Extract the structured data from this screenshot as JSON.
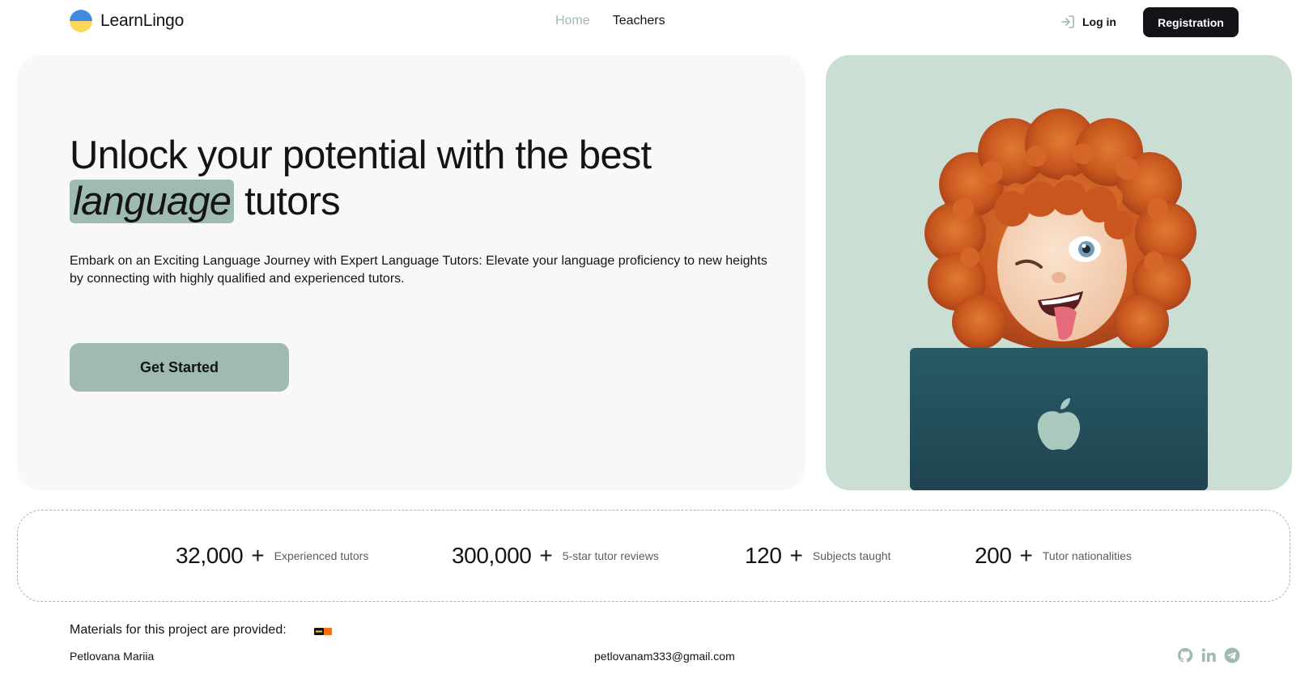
{
  "brand": {
    "name": "LearnLingo",
    "colors": {
      "accent": "#9FBAAE",
      "dark": "#121417",
      "hero_bg": "#f8f8f8",
      "image_bg": "#CBDED3",
      "flag_blue": "#3F8AE0",
      "flag_yellow": "#FBD75B"
    }
  },
  "nav": {
    "items": [
      {
        "label": "Home",
        "active": true
      },
      {
        "label": "Teachers",
        "active": false
      }
    ]
  },
  "auth": {
    "login_label": "Log in",
    "register_label": "Registration"
  },
  "hero": {
    "title_part1": "Unlock your potential with the best",
    "title_highlight": "language",
    "title_part2": "tutors",
    "description": "Embark on an Exciting Language Journey with Expert Language Tutors: Elevate your language proficiency to new heights by connecting with highly qualified and experienced tutors.",
    "cta_label": "Get Started",
    "image_icon": "memoji-with-laptop"
  },
  "stats": [
    {
      "value": "32,000",
      "plus": "+",
      "label": "Experienced tutors"
    },
    {
      "value": "300,000",
      "plus": "+",
      "label": "5-star tutor reviews"
    },
    {
      "value": "120",
      "plus": "+",
      "label": "Subjects taught"
    },
    {
      "value": "200",
      "plus": "+",
      "label": "Tutor nationalities"
    }
  ],
  "footer": {
    "materials_label": "Materials for this project are provided:",
    "author": "Petlovana Mariia",
    "email": "petlovanam333@gmail.com",
    "social_icons": [
      "github-icon",
      "linkedin-icon",
      "telegram-icon"
    ]
  }
}
